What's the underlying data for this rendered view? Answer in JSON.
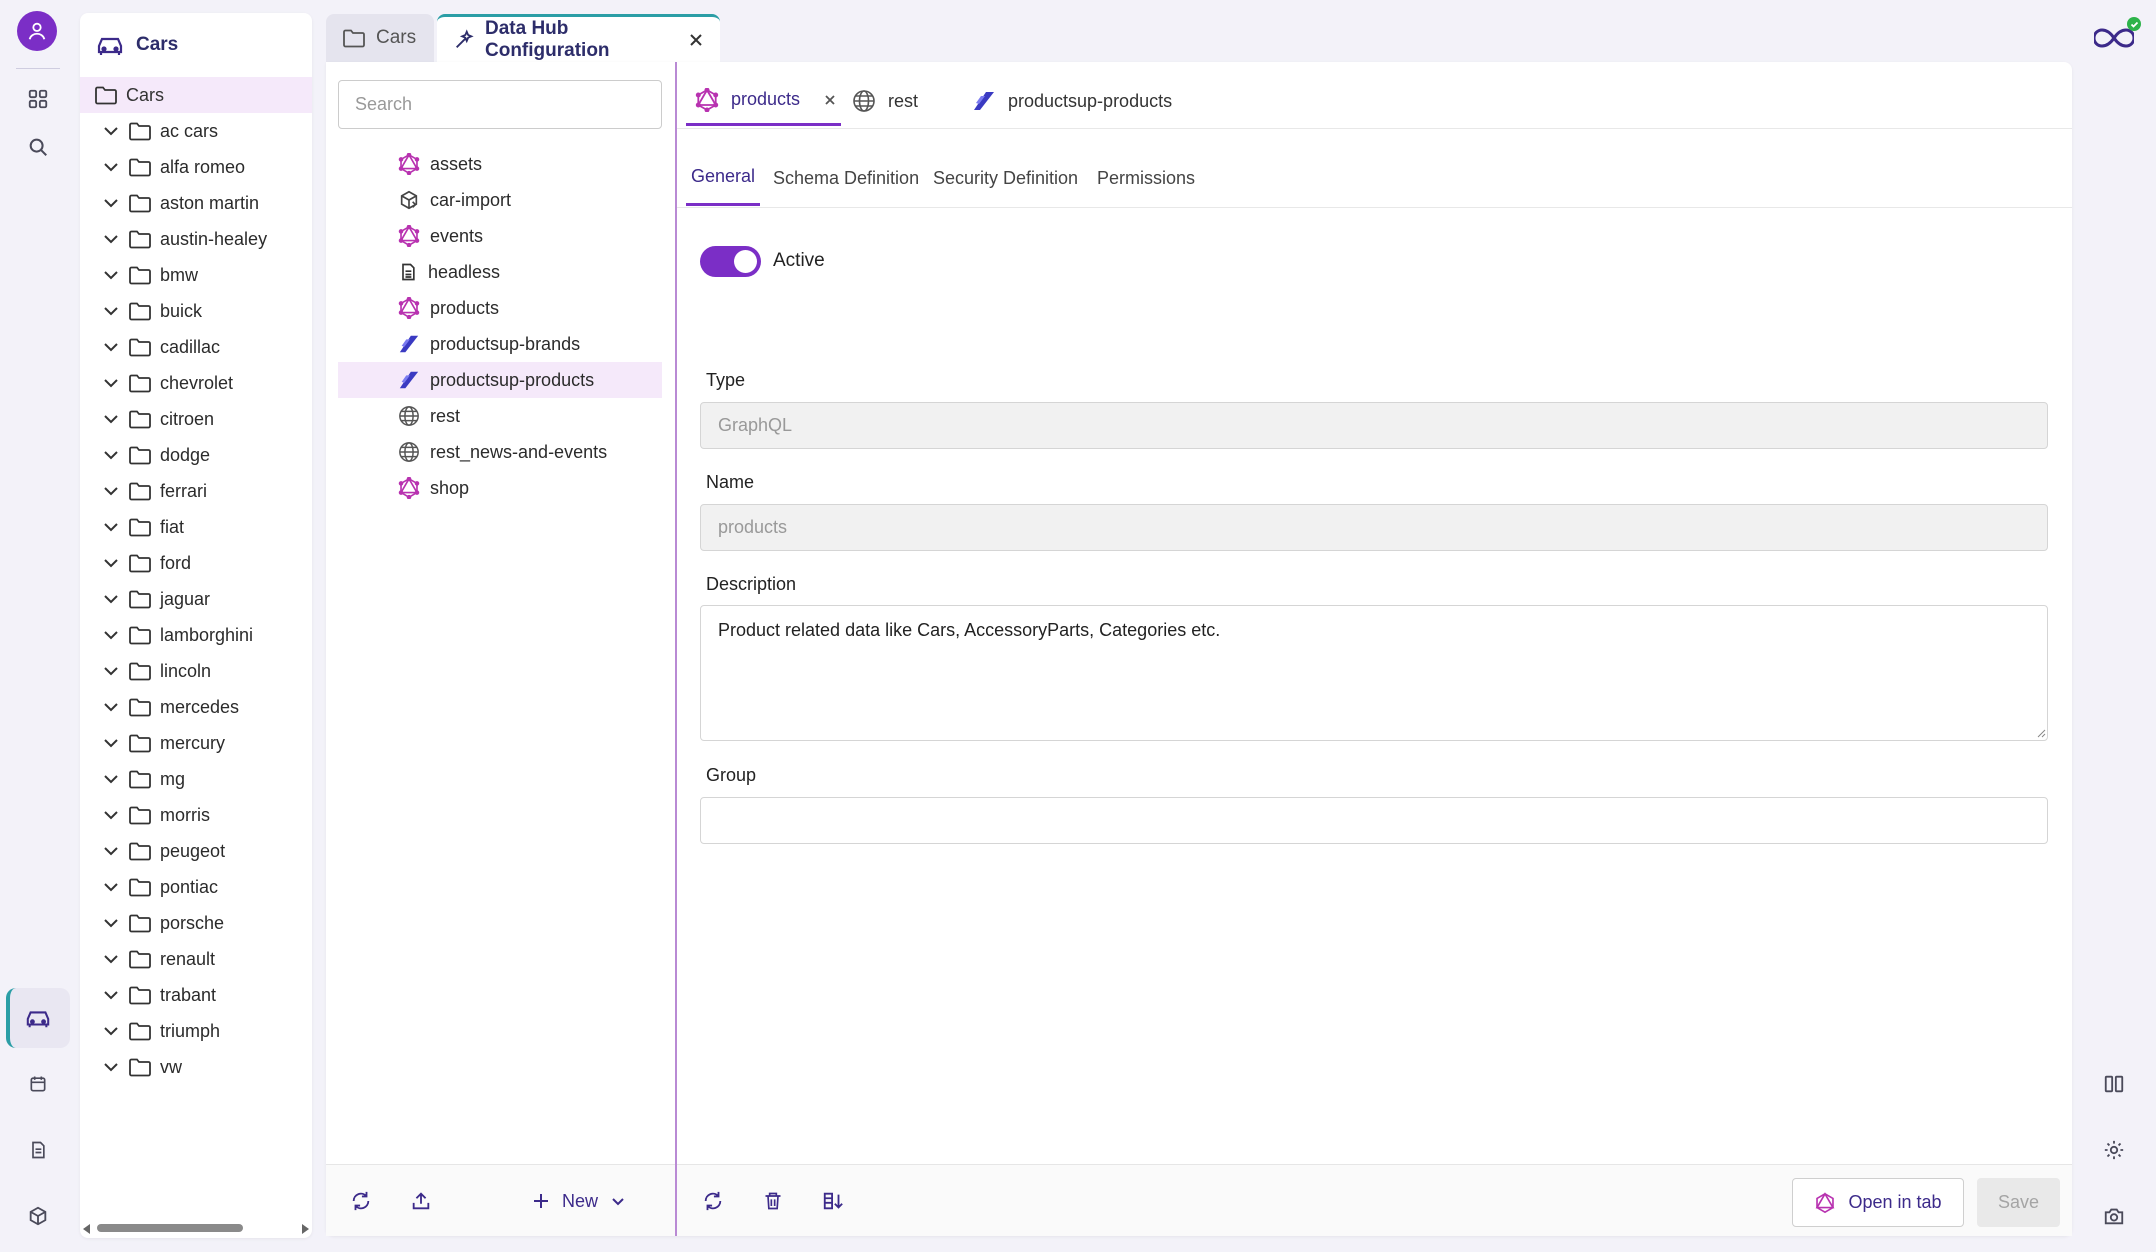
{
  "app": {
    "colors": {
      "accent": "#7b2ec6",
      "teal": "#2b9ea6",
      "navy": "#3c2a8a",
      "selected_bg": "#f5e9fa"
    }
  },
  "rail": {
    "items": [
      {
        "icon": "user-avatar-icon"
      },
      {
        "icon": "grid-icon"
      },
      {
        "icon": "search-icon"
      },
      {
        "icon": "car-icon",
        "active": true
      },
      {
        "icon": "calendar-icon"
      },
      {
        "icon": "document-icon"
      },
      {
        "icon": "cube-icon"
      }
    ]
  },
  "tree": {
    "header": "Cars",
    "root": "Cars",
    "items": [
      "ac cars",
      "alfa romeo",
      "aston martin",
      "austin-healey",
      "bmw",
      "buick",
      "cadillac",
      "chevrolet",
      "citroen",
      "dodge",
      "ferrari",
      "fiat",
      "ford",
      "jaguar",
      "lamborghini",
      "lincoln",
      "mercedes",
      "mercury",
      "mg",
      "morris",
      "peugeot",
      "pontiac",
      "porsche",
      "renault",
      "trabant",
      "triumph",
      "vw"
    ]
  },
  "tabs": {
    "cars": "Cars",
    "config": "Data Hub Configuration"
  },
  "sidebar": {
    "search_placeholder": "Search",
    "items": [
      {
        "label": "assets",
        "icon": "graphql-icon"
      },
      {
        "label": "car-import",
        "icon": "import-icon"
      },
      {
        "label": "events",
        "icon": "graphql-icon"
      },
      {
        "label": "headless",
        "icon": "document-icon"
      },
      {
        "label": "products",
        "icon": "graphql-icon"
      },
      {
        "label": "productsup-brands",
        "icon": "productsup-icon"
      },
      {
        "label": "productsup-products",
        "icon": "productsup-icon",
        "selected": true
      },
      {
        "label": "rest",
        "icon": "globe-icon"
      },
      {
        "label": "rest_news-and-events",
        "icon": "globe-icon"
      },
      {
        "label": "shop",
        "icon": "graphql-icon"
      }
    ],
    "new_label": "New"
  },
  "editor": {
    "tabs": {
      "products": "products",
      "rest": "rest",
      "productsup": "productsup-products"
    },
    "subtabs": {
      "general": "General",
      "schema": "Schema Definition",
      "security": "Security Definition",
      "permissions": "Permissions"
    },
    "active_label": "Active",
    "active_on": true,
    "type_label": "Type",
    "type_value": "GraphQL",
    "name_label": "Name",
    "name_value": "products",
    "description_label": "Description",
    "description_value": "Product related data like Cars, AccessoryParts, Categories etc.",
    "group_label": "Group",
    "group_value": "",
    "open_in_tab": "Open in tab",
    "save": "Save"
  }
}
